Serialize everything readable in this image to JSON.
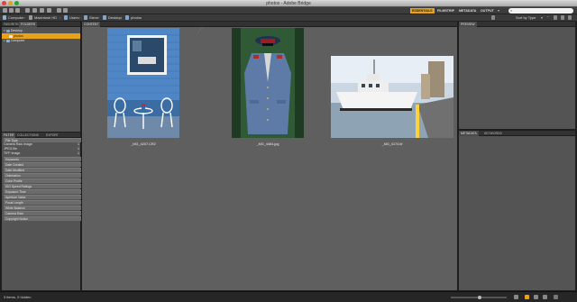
{
  "window": {
    "title": "photos - Adobe Bridge"
  },
  "appbar": {
    "workspaces": [
      "ESSENTIALS",
      "FILMSTRIP",
      "METADATA",
      "OUTPUT"
    ],
    "active_workspace": "ESSENTIALS",
    "search_placeholder": ""
  },
  "path": {
    "crumbs": [
      "Computer",
      "Macintosh HD",
      "Users",
      "Steve",
      "Desktop",
      "photos"
    ]
  },
  "left_panel": {
    "tabs": [
      "FAVORITES",
      "FOLDERS"
    ],
    "active_tab": "FOLDERS",
    "tree": [
      {
        "label": "Desktop",
        "indent": 0,
        "selected": false
      },
      {
        "label": "photos",
        "indent": 1,
        "selected": true
      },
      {
        "label": "Computer",
        "indent": 0,
        "selected": false
      }
    ]
  },
  "filter_panel": {
    "tabs": [
      "FILTER",
      "COLLECTIONS",
      "EXPORT"
    ],
    "active_tab": "FILTER",
    "file_type_header": "File Type",
    "file_types": [
      {
        "label": "Camera Raw image",
        "count": "1"
      },
      {
        "label": "JPEG file",
        "count": "1"
      },
      {
        "label": "TIFF image",
        "count": "1"
      }
    ],
    "categories": [
      "Keywords",
      "Date Created",
      "Date Modified",
      "Orientation",
      "Color Profile",
      "ISO Speed Ratings",
      "Exposure Time",
      "Aperture Value",
      "Focal Length",
      "White Balance",
      "Camera Raw",
      "Copyright Notice"
    ]
  },
  "content_panel": {
    "tab": "CONTENT",
    "items": [
      {
        "filename": "_MG_4207.CR2"
      },
      {
        "filename": "_MG_4464.jpg"
      },
      {
        "filename": "_MG_4174.tif"
      }
    ],
    "colors": {
      "selected_bg": "#3d3d3d"
    }
  },
  "right_panel": {
    "preview_tab": "PREVIEW",
    "metadata_tabs": [
      "METADATA",
      "KEYWORDS"
    ]
  },
  "toolbar": {
    "sort_label": "Sort by Type"
  },
  "status": {
    "text": "3 items, 0 hidden"
  },
  "colors": {
    "accent": "#e8a21a",
    "panel": "#545454",
    "content_bg": "#5f5f5f"
  }
}
